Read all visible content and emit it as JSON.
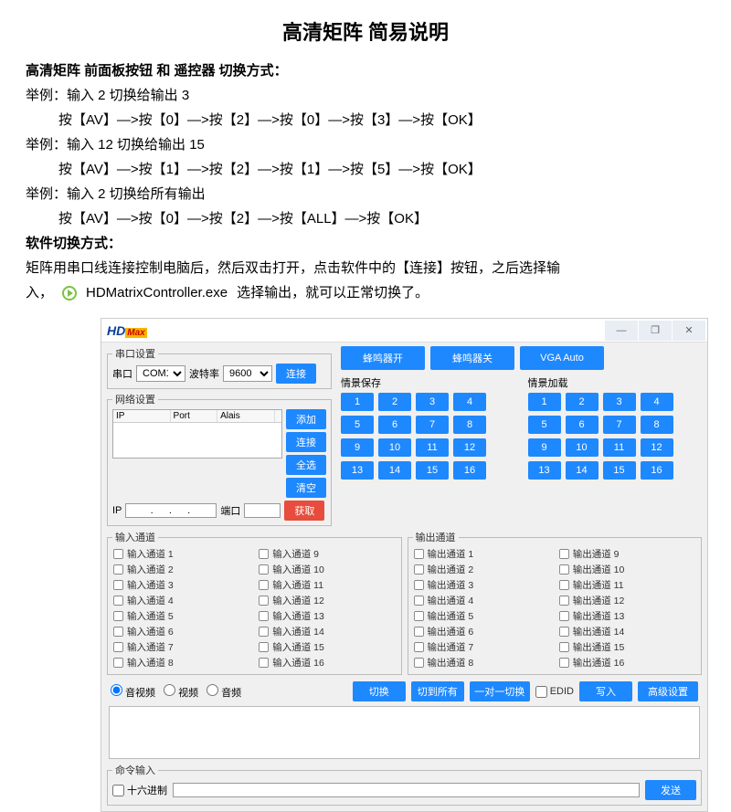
{
  "title": "高清矩阵  简易说明",
  "doc": {
    "heading1": "高清矩阵 前面板按钮 和 遥控器 切换方式：",
    "ex1a": "举例：输入 2 切换给输出 3",
    "ex1b": "按【AV】—>按【0】—>按【2】—>按【0】—>按【3】—>按【OK】",
    "ex2a": "举例：输入 12 切换给输出 15",
    "ex2b": "按【AV】—>按【1】—>按【2】—>按【1】—>按【5】—>按【OK】",
    "ex3a": "举例：输入 2 切换给所有输出",
    "ex3b": "按【AV】—>按【0】—>按【2】—>按【ALL】—>按【OK】",
    "heading2": "软件切换方式：",
    "sw1": "矩阵用串口线连接控制电脑后，然后双击打开，点击软件中的【连接】按钮，之后选择输",
    "sw2a": "入，",
    "exe": "HDMatrixController.exe",
    "sw2b": "选择输出，就可以正常切换了。"
  },
  "app": {
    "logo_hd": "HD",
    "logo_max": "Max",
    "win_min": "—",
    "win_max": "❐",
    "win_close": "✕",
    "serial": {
      "legend": "串口设置",
      "port_lbl": "串口",
      "port_val": "COM1",
      "baud_lbl": "波特率",
      "baud_val": "9600",
      "connect": "连接"
    },
    "net": {
      "legend": "网络设置",
      "col_ip": "IP",
      "col_port": "Port",
      "col_alias": "Alais",
      "add": "添加",
      "connect": "连接",
      "all": "全选",
      "clear": "清空",
      "ip_lbl": "IP",
      "ip_val": ".   .   .",
      "port_lbl": "端口",
      "port_val": "",
      "get": "获取"
    },
    "topbtns": {
      "buzzer_on": "蜂鸣器开",
      "buzzer_off": "蜂鸣器关",
      "vga": "VGA Auto"
    },
    "scene_save": "情景保存",
    "scene_load": "情景加载",
    "scene_nums": [
      "1",
      "2",
      "3",
      "4",
      "5",
      "6",
      "7",
      "8",
      "9",
      "10",
      "11",
      "12",
      "13",
      "14",
      "15",
      "16"
    ],
    "in_legend": "输入通道",
    "out_legend": "输出通道",
    "in_prefix": "输入通道 ",
    "out_prefix": "输出通道 ",
    "chan_nums": [
      "1",
      "2",
      "3",
      "4",
      "5",
      "6",
      "7",
      "8",
      "9",
      "10",
      "11",
      "12",
      "13",
      "14",
      "15",
      "16"
    ],
    "av": {
      "av_video": "音视频",
      "video": "视频",
      "audio": "音频",
      "switch": "切换",
      "switch_all": "切到所有",
      "one2one": "一对一切换",
      "edid": "EDID",
      "write": "写入",
      "adv": "高级设置"
    },
    "cmd": {
      "legend": "命令输入",
      "hex": "十六进制",
      "send": "发送"
    }
  }
}
